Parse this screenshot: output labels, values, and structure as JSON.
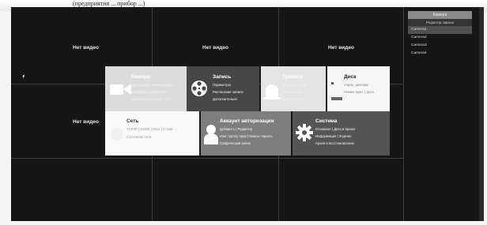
{
  "photo_header": "(предприятия ... прибор ...)",
  "grid": {
    "no_video": "Нет видео"
  },
  "panel": {
    "header": "Камера",
    "subheader": "Редактор экрана",
    "cameras": [
      "Camera1",
      "Camera2",
      "Camera3",
      "Camera4"
    ]
  },
  "tiles": {
    "camera": {
      "title": "Камера",
      "lines": [
        "Доб. камеру | Имя камеры",
        "Настройки | Движение",
        "Интеллектуальный | PTZ"
      ]
    },
    "record": {
      "title": "Запись",
      "lines": [
        "Параметры",
        "Расписание записи",
        "Дополнительно"
      ]
    },
    "alarm": {
      "title": "Тревога",
      "lines": [
        "Тревога датчик",
        "Трев. выход",
        "Трев. по дате"
      ]
    },
    "disk": {
      "title": "Диск",
      "lines": [
        "Управ. дисками",
        "Режим хран. | Диск"
      ]
    },
    "network": {
      "title": "Сеть",
      "lines": [
        "TCP/IP | DDNS | Порт | E-mail",
        "Состояние сети"
      ]
    },
    "account": {
      "title": "Аккаунт авторизации",
      "lines": [
        "Добавить | Редактор",
        "Изм. группу прав | Измен. пароль",
        "Графический замок"
      ]
    },
    "system": {
      "title": "Система",
      "lines": [
        "Основное | Дата и время",
        "Информация | Журнал",
        "Архив и восстановление"
      ]
    }
  },
  "colors": {
    "screen_bg": "#161616",
    "camera_tile": "#dcdcdc",
    "record_tile": "#474747",
    "alarm_tile": "#e4e4e4",
    "disk_tile": "#f6f6f6",
    "network_tile": "#f8f8f8",
    "account_tile": "#7e7e7e",
    "system_tile": "#555555"
  }
}
